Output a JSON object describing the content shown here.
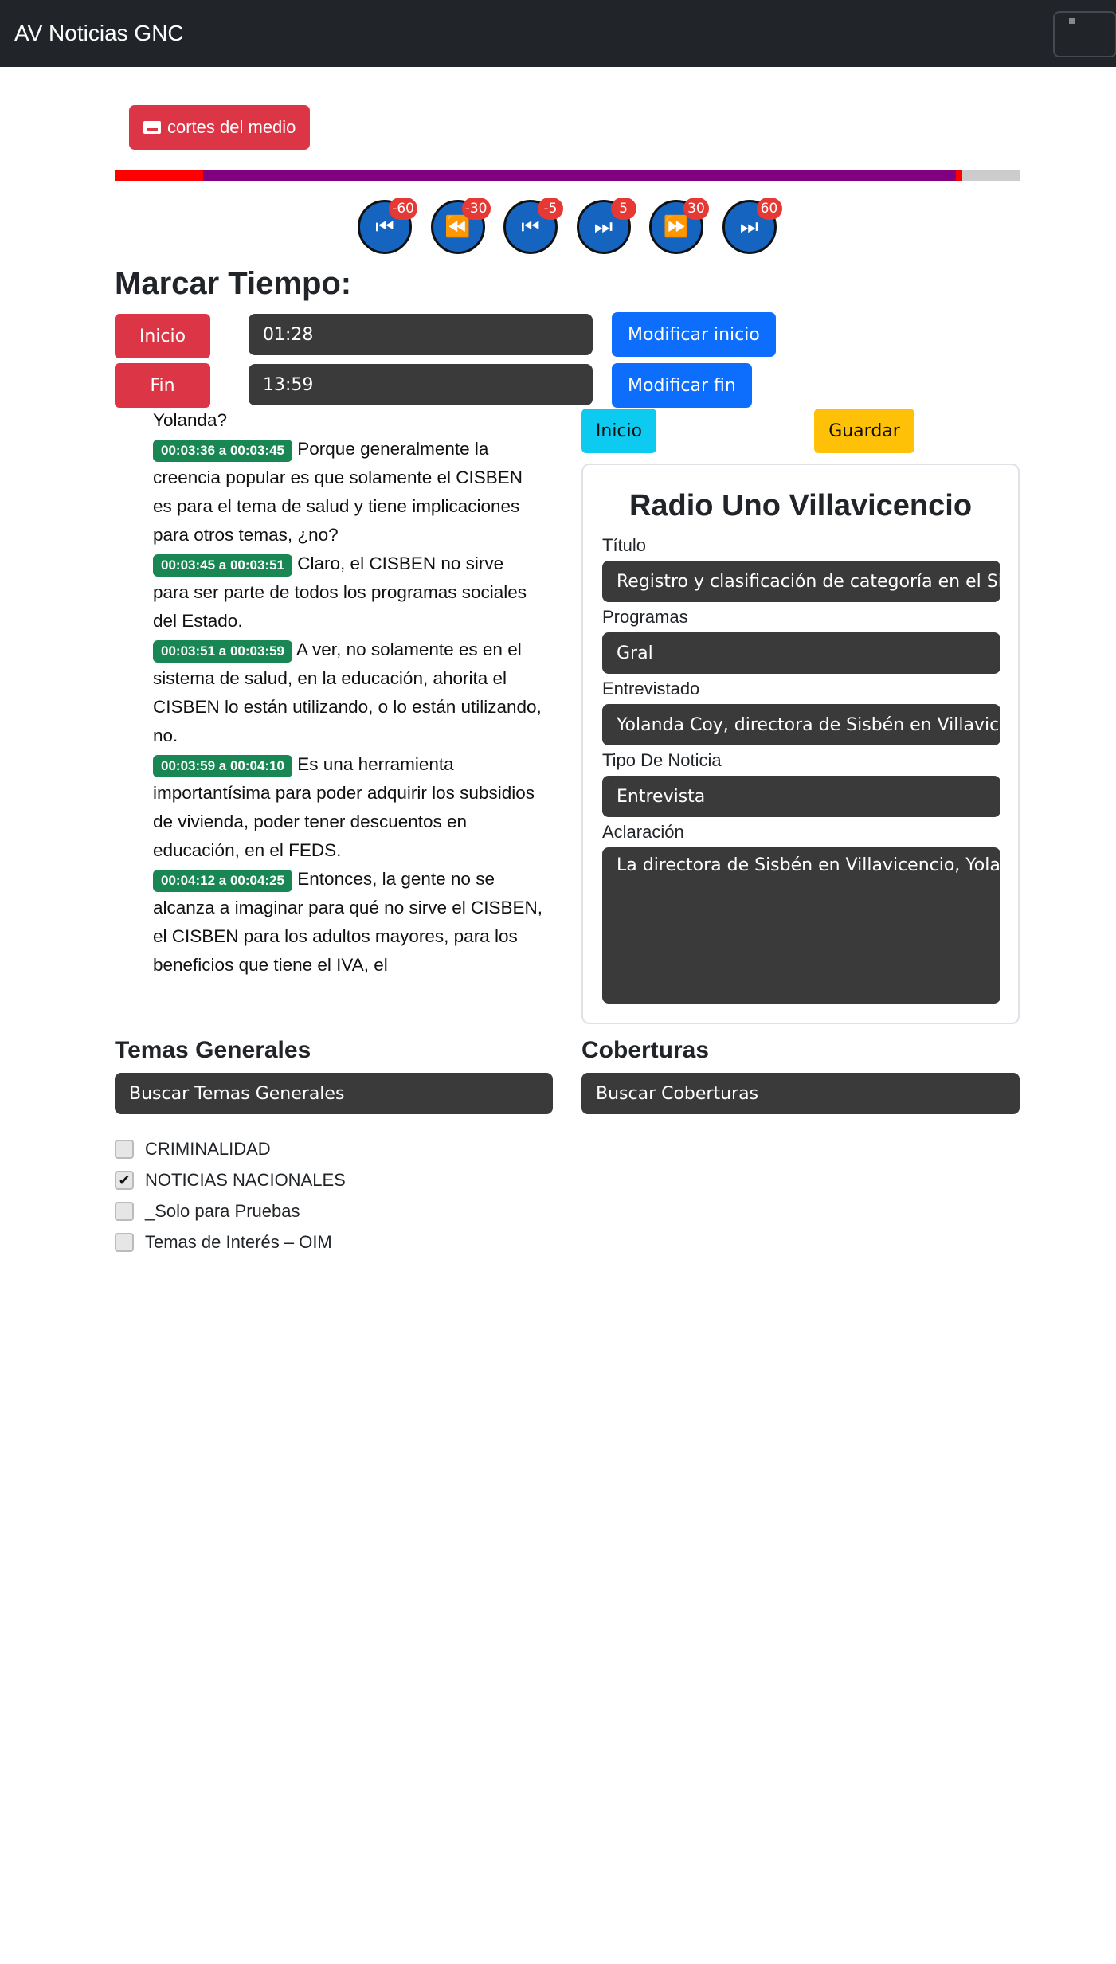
{
  "navbar": {
    "brand": "AV Noticias GNC"
  },
  "cortes_button": {
    "label": "cortes del medio",
    "icon": "subtitles-icon"
  },
  "progress": {
    "segments": [
      {
        "start": 0,
        "end": 0.098,
        "color": "#ff0000"
      },
      {
        "start": 0.098,
        "end": 0.93,
        "color": "#800080"
      },
      {
        "start": 0.93,
        "end": 0.937,
        "color": "#ff0000"
      }
    ],
    "track_color": "#cccccc"
  },
  "controls": [
    {
      "name": "skip-back-60",
      "glyph": "⏮",
      "badge": "-60"
    },
    {
      "name": "skip-back-30",
      "glyph": "⏪",
      "badge": "-30"
    },
    {
      "name": "skip-back-5",
      "glyph": "⏮",
      "badge": "-5"
    },
    {
      "name": "skip-forward-5",
      "glyph": "⏭",
      "badge": "5"
    },
    {
      "name": "skip-forward-30",
      "glyph": "⏩",
      "badge": "30"
    },
    {
      "name": "skip-forward-60",
      "glyph": "⏭",
      "badge": "60"
    }
  ],
  "marcar": {
    "heading": "Marcar Tiempo:",
    "inicio_label": "Inicio",
    "inicio_value": "01:28",
    "modificar_inicio": "Modificar inicio",
    "fin_label": "Fin",
    "fin_value": "13:59",
    "modificar_fin": "Modificar fin"
  },
  "transcript": {
    "lead": "Yolanda?",
    "entries": [
      {
        "time": "00:03:36 a 00:03:45",
        "text": "Porque generalmente la creencia popular es que solamente el CISBEN es para el tema de salud y tiene implicaciones para otros temas, ¿no?"
      },
      {
        "time": "00:03:45 a 00:03:51",
        "text": "Claro, el CISBEN no sirve para ser parte de todos los programas sociales del Estado."
      },
      {
        "time": "00:03:51 a 00:03:59",
        "text": "A ver, no solamente es en el sistema de salud, en la educación, ahorita el CISBEN lo están utilizando, o lo están utilizando, no."
      },
      {
        "time": "00:03:59 a 00:04:10",
        "text": "Es una herramienta importantísima para poder adquirir los subsidios de vivienda, poder tener descuentos en educación, en el FEDS."
      },
      {
        "time": "00:04:12 a 00:04:25",
        "text": "Entonces, la gente no se alcanza a imaginar para qué no sirve el CISBEN, el CISBEN para los adultos mayores, para los beneficios que tiene el IVA, el"
      }
    ]
  },
  "actions": {
    "inicio": "Inicio",
    "guardar": "Guardar"
  },
  "form": {
    "title": "Radio Uno Villavicencio",
    "titulo_label": "Título",
    "titulo_value": "Registro y clasificación de categoría en el Sis",
    "programas_label": "Programas",
    "programas_value": "Gral",
    "entrevistado_label": "Entrevistado",
    "entrevistado_value": "Yolanda Coy, directora de Sisbén en Villavice",
    "tipo_label": "Tipo De Noticia",
    "tipo_value": "Entrevista",
    "aclaracion_label": "Aclaración",
    "aclaracion_value": "La directora de Sisbén en Villavicencio, Yolan"
  },
  "temas": {
    "title": "Temas Generales",
    "search_placeholder": "Buscar Temas Generales",
    "items": [
      {
        "label": "CRIMINALIDAD",
        "checked": false
      },
      {
        "label": "NOTICIAS NACIONALES",
        "checked": true
      },
      {
        "label": "_Solo para Pruebas",
        "checked": false
      },
      {
        "label": "Temas de Interés – OIM",
        "checked": false
      }
    ]
  },
  "coberturas": {
    "title": "Coberturas",
    "search_placeholder": "Buscar Coberturas"
  }
}
